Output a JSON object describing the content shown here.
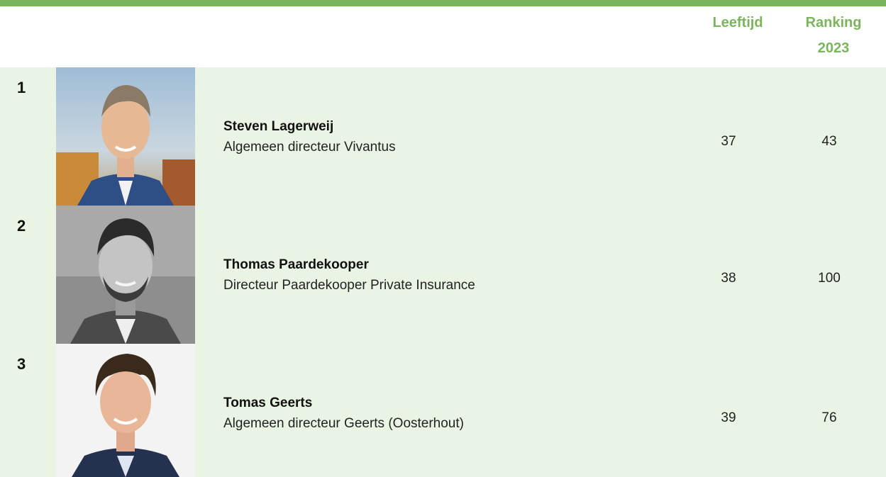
{
  "header": {
    "age_label": "Leeftijd",
    "ranking_label_line1": "Ranking",
    "ranking_label_line2": "2023"
  },
  "colors": {
    "accent": "#7ab55c",
    "row_bg": "#eaf4e4"
  },
  "entries": [
    {
      "rank": "1",
      "name": "Steven Lagerweij",
      "title": "Algemeen directeur Vivantus",
      "age": "37",
      "ranking_2023": "43"
    },
    {
      "rank": "2",
      "name": "Thomas Paardekooper",
      "title": "Directeur Paardekooper Private Insurance",
      "age": "38",
      "ranking_2023": "100"
    },
    {
      "rank": "3",
      "name": "Tomas Geerts",
      "title": "Algemeen directeur Geerts (Oosterhout)",
      "age": "39",
      "ranking_2023": "76"
    }
  ]
}
